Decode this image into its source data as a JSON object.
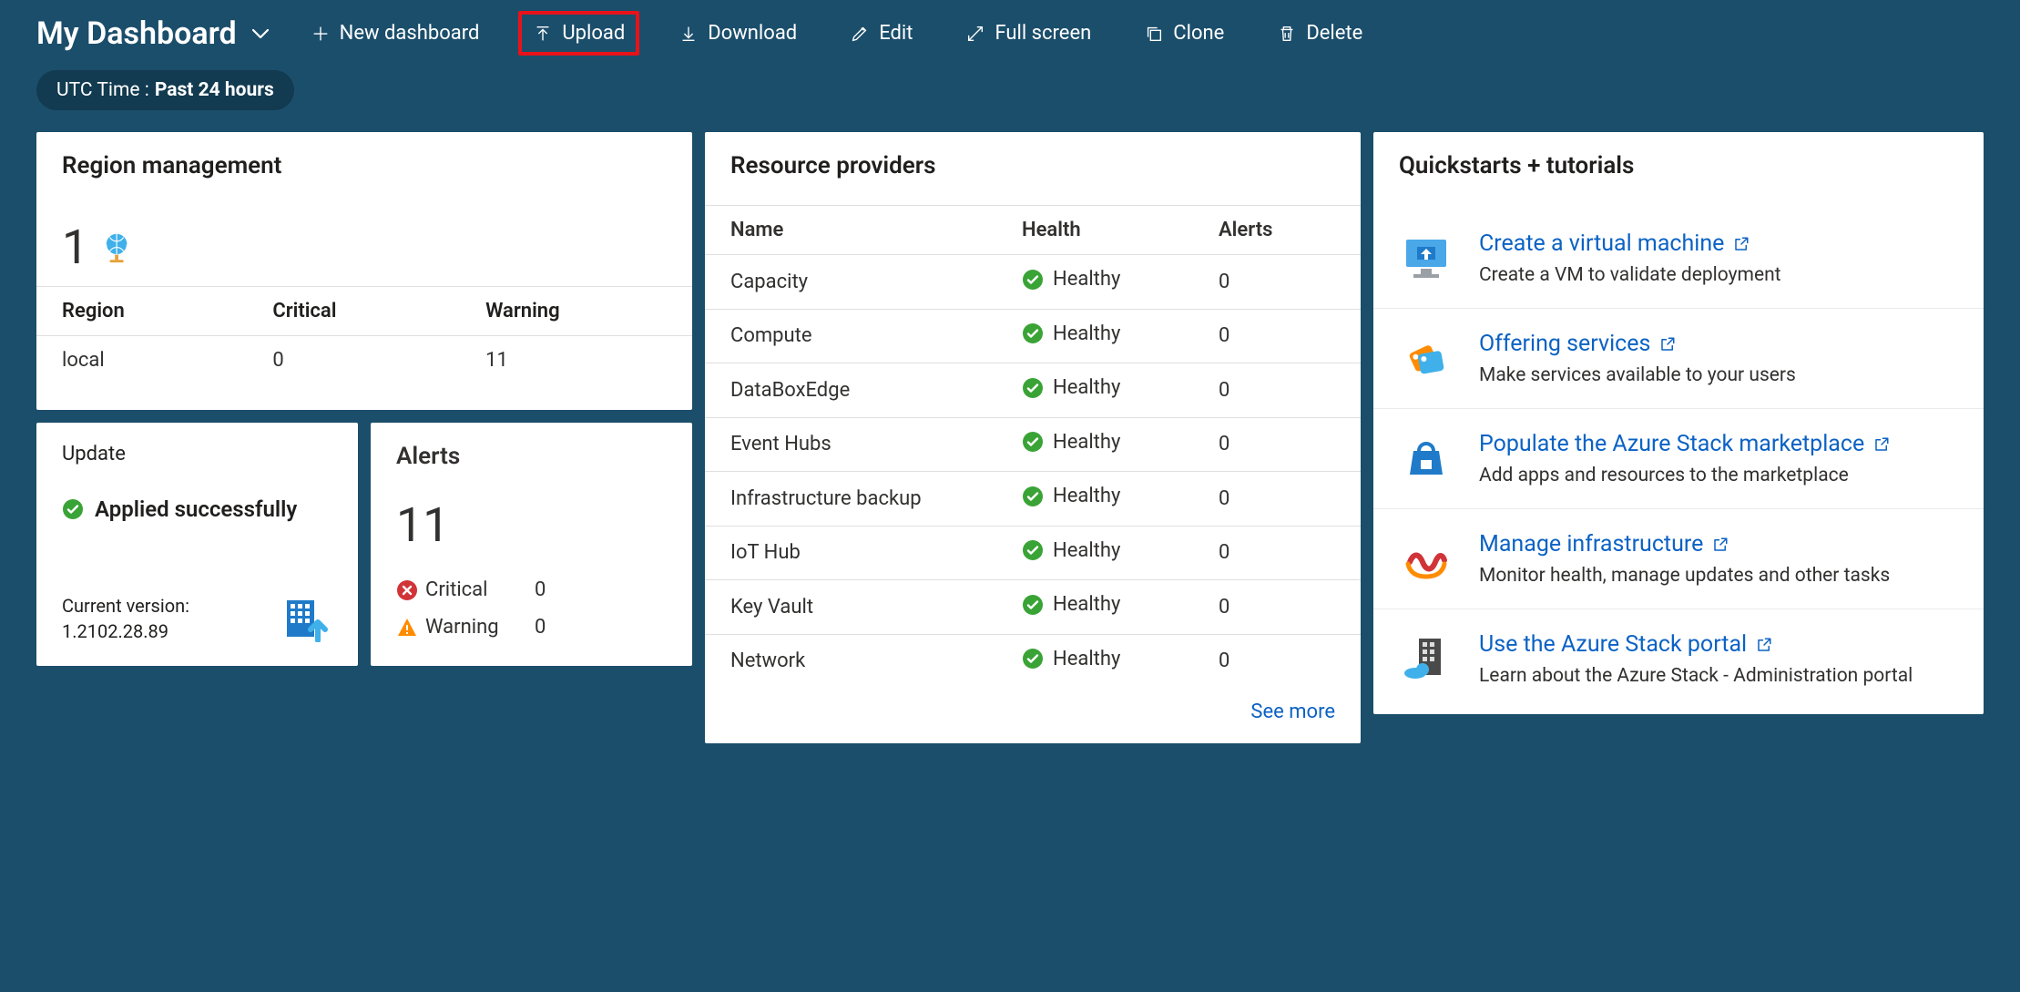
{
  "header": {
    "title": "My Dashboard",
    "buttons": {
      "new": "New dashboard",
      "upload": "Upload",
      "download": "Download",
      "edit": "Edit",
      "fullscreen": "Full screen",
      "clone": "Clone",
      "delete": "Delete"
    },
    "time_filter_prefix": "UTC Time :",
    "time_filter_value": "Past 24 hours"
  },
  "region_mgmt": {
    "title": "Region management",
    "count": "1",
    "columns": {
      "region": "Region",
      "critical": "Critical",
      "warning": "Warning"
    },
    "rows": [
      {
        "region": "local",
        "critical": "0",
        "warning": "11"
      }
    ]
  },
  "update": {
    "title": "Update",
    "status": "Applied successfully",
    "version_label": "Current version:",
    "version": "1.2102.28.89"
  },
  "alerts": {
    "title": "Alerts",
    "count": "11",
    "rows": [
      {
        "icon": "error",
        "label": "Critical",
        "value": "0"
      },
      {
        "icon": "warning",
        "label": "Warning",
        "value": "0"
      }
    ]
  },
  "resource_providers": {
    "title": "Resource providers",
    "columns": {
      "name": "Name",
      "health": "Health",
      "alerts": "Alerts"
    },
    "rows": [
      {
        "name": "Capacity",
        "health": "Healthy",
        "alerts": "0"
      },
      {
        "name": "Compute",
        "health": "Healthy",
        "alerts": "0"
      },
      {
        "name": "DataBoxEdge",
        "health": "Healthy",
        "alerts": "0"
      },
      {
        "name": "Event Hubs",
        "health": "Healthy",
        "alerts": "0"
      },
      {
        "name": "Infrastructure backup",
        "health": "Healthy",
        "alerts": "0"
      },
      {
        "name": "IoT Hub",
        "health": "Healthy",
        "alerts": "0"
      },
      {
        "name": "Key Vault",
        "health": "Healthy",
        "alerts": "0"
      },
      {
        "name": "Network",
        "health": "Healthy",
        "alerts": "0"
      }
    ],
    "see_more": "See more"
  },
  "quickstarts": {
    "title": "Quickstarts + tutorials",
    "items": [
      {
        "icon": "vm",
        "link": "Create a virtual machine",
        "desc": "Create a VM to validate deployment"
      },
      {
        "icon": "offer",
        "link": "Offering services",
        "desc": "Make services available to your users"
      },
      {
        "icon": "marketplace",
        "link": "Populate the Azure Stack marketplace",
        "desc": "Add apps and resources to the marketplace"
      },
      {
        "icon": "infra",
        "link": "Manage infrastructure",
        "desc": "Monitor health, manage updates and other tasks"
      },
      {
        "icon": "portal",
        "link": "Use the Azure Stack portal",
        "desc": "Learn about the Azure Stack - Administration portal"
      }
    ]
  }
}
